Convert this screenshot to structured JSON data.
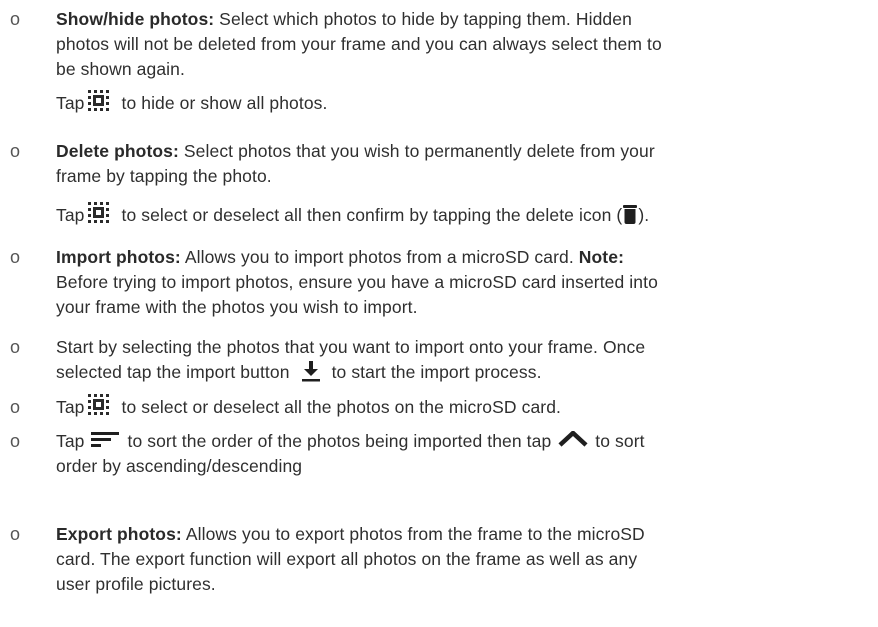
{
  "items": [
    {
      "bullet": "o",
      "bold": "Show/hide photos:",
      "lines": [
        " Select which photos to hide by tapping them. Hidden",
        "photos will not be deleted from your frame and you can always select them to",
        "be shown again."
      ],
      "extra": {
        "pre": "Tap",
        "post": " to hide or show all photos."
      }
    },
    {
      "bullet": "o",
      "bold": "Delete photos:",
      "lines": [
        " Select photos that you wish to permanently delete from your",
        "frame by tapping the photo."
      ],
      "extra": {
        "pre": "Tap",
        "post": " to select or deselect all then confirm by tapping the delete icon (",
        "end": ")."
      }
    },
    {
      "bullet": "o",
      "bold": "Import photos:",
      "line1_rest": " Allows you to import photos from a microSD card. ",
      "note_bold": "Note:",
      "lines": [
        "Before trying to import photos, ensure you have a microSD card inserted into",
        "your frame with the photos you wish to import."
      ]
    },
    {
      "bullet": "o",
      "lines": [
        "Start by selecting the photos that you want to import onto your frame. Once"
      ],
      "line2_pre": "selected tap the import button",
      "line2_post": "to start the import process."
    },
    {
      "bullet": "o",
      "pre": "Tap",
      "post": " to select or deselect all the photos on the microSD card."
    },
    {
      "bullet": "o",
      "pre": "Tap",
      "mid": "to sort the order of the photos being imported then tap",
      "post": "to sort",
      "line2": "order by ascending/descending"
    },
    {
      "bullet": "o",
      "bold": "Export photos:",
      "lines": [
        " Allows you to export photos from the frame to the microSD",
        "card. The export function will export all photos on the frame as well as any",
        "user profile pictures."
      ]
    }
  ],
  "icons": {
    "select_all": "select-all-icon",
    "trash": "trash-icon",
    "import": "download-icon",
    "sort": "sort-lines-icon",
    "order": "chevron-up-icon"
  },
  "colors": {
    "text": "#2f2f2f",
    "icon": "#2b2b2b"
  }
}
